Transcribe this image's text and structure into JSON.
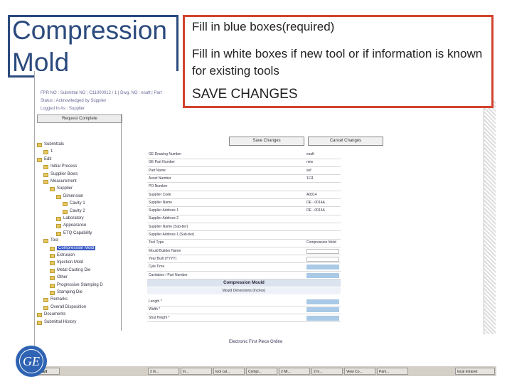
{
  "slide": {
    "title": "Compression\nMold",
    "callout": {
      "line1": "Fill in blue boxes(required)",
      "line2": "Fill in white boxes if new tool or if information is known for existing tools",
      "line3": "SAVE CHANGES"
    }
  },
  "app": {
    "info_line1": "FPR NO : Submittal NO : C11000012 / 1 | Dwg. NO : esaft | Part",
    "info_line2": "Status : Acknowledged by Supplier",
    "info_line3": "Logged In As : Supplier",
    "request_button": "Request Complete",
    "save_changes": "Save Changes",
    "cancel_changes": "Cancel Changes",
    "footer": "Electronic First Piece Online"
  },
  "tree": [
    {
      "label": "Submittals",
      "level": 0
    },
    {
      "label": "1",
      "level": 1
    },
    {
      "label": "Edit",
      "level": 0
    },
    {
      "label": "Initial Process",
      "level": 1
    },
    {
      "label": "Supplier Bows",
      "level": 1
    },
    {
      "label": "Measurement",
      "level": 1
    },
    {
      "label": "Supplier",
      "level": 2
    },
    {
      "label": "Dimension",
      "level": 3
    },
    {
      "label": "Cavity 1",
      "level": 4
    },
    {
      "label": "Cavity 2",
      "level": 4
    },
    {
      "label": "Laboratory",
      "level": 3
    },
    {
      "label": "Appearance",
      "level": 3
    },
    {
      "label": "ETQ Capability",
      "level": 3
    },
    {
      "label": "Tool",
      "level": 1
    },
    {
      "label": "Compression Mold",
      "level": 2,
      "selected": true
    },
    {
      "label": "Extrusion",
      "level": 2
    },
    {
      "label": "Injection Mold",
      "level": 2
    },
    {
      "label": "Metal Casting Die",
      "level": 2
    },
    {
      "label": "Other",
      "level": 2
    },
    {
      "label": "Progressive Stamping D",
      "level": 2
    },
    {
      "label": "Stamping Die",
      "level": 2
    },
    {
      "label": "Remarks",
      "level": 1
    },
    {
      "label": "Overall Disposition",
      "level": 1
    },
    {
      "label": "Documents",
      "level": 0
    },
    {
      "label": "Submittal History",
      "level": 0
    }
  ],
  "form_rows": [
    {
      "label": "GE Drawing Number",
      "value": "esaft",
      "kind": "text"
    },
    {
      "label": "GE Part Number",
      "value": "new",
      "kind": "text"
    },
    {
      "label": "Part Name",
      "value": "sef",
      "kind": "text"
    },
    {
      "label": "Asset Number",
      "value": "1111",
      "kind": "text"
    },
    {
      "label": "PO Number",
      "value": "",
      "kind": "text"
    },
    {
      "label": "Supplier Code",
      "value": "A0014",
      "kind": "text"
    },
    {
      "label": "Supplier Name",
      "value": "DE - 0014A",
      "kind": "text"
    },
    {
      "label": "Supplier Address 1",
      "value": "DE - 0014A",
      "kind": "text"
    },
    {
      "label": "Supplier Address 2",
      "value": "",
      "kind": "text"
    },
    {
      "label": "Supplier Name (Sub-tier)",
      "value": "",
      "kind": "text"
    },
    {
      "label": "Supplier Address 1 (Sub-tier)",
      "value": "",
      "kind": "text"
    },
    {
      "label": "Tool Type",
      "value": "Compression Mold",
      "kind": "text"
    },
    {
      "label": "Mould Builder Name",
      "value": "",
      "kind": "white"
    },
    {
      "label": "Year Built (YYYY)",
      "value": "",
      "kind": "white"
    },
    {
      "label": "Cyle Time",
      "value": "",
      "kind": "blue"
    },
    {
      "label": "Cavitation / Part Number",
      "value": "",
      "kind": "blue"
    }
  ],
  "section": {
    "head": "Compression Mould",
    "sub": "Mould Dimensions (Inches)"
  },
  "dim_rows": [
    {
      "label": "Length *",
      "kind": "blue"
    },
    {
      "label": "Width *",
      "kind": "blue"
    },
    {
      "label": "Shut Height *",
      "kind": "blue"
    }
  ],
  "taskbar": {
    "start": "Start",
    "items": [
      "2 In...",
      "In...",
      "tool cal...",
      "Compr...",
      "2 Mi...",
      "2 In...",
      "View Co...",
      "Pam..."
    ],
    "clock": "local intranet"
  },
  "colors": {
    "title": "#2b4a7e",
    "callout_border": "#d3432d",
    "required_fill": "#a9c9e6",
    "selected": "#3a5ac6"
  },
  "logo": "GE"
}
